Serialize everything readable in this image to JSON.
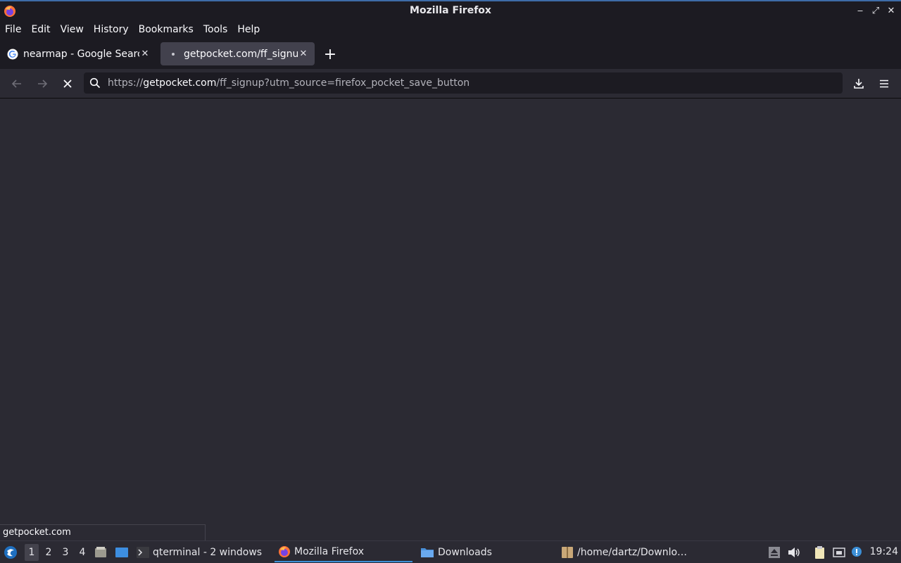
{
  "window": {
    "title": "Mozilla Firefox",
    "controls": [
      "minimize-icon",
      "maximize-icon",
      "close-icon"
    ]
  },
  "menubar": {
    "items": [
      "File",
      "Edit",
      "View",
      "History",
      "Bookmarks",
      "Tools",
      "Help"
    ]
  },
  "tabs": [
    {
      "label": "nearmap - Google Search",
      "icon": "google-icon",
      "active": false
    },
    {
      "label": "getpocket.com/ff_signup",
      "icon": "loading-dot-icon",
      "active": true
    }
  ],
  "navbar": {
    "url_prefix": "https://",
    "url_host": "getpocket.com",
    "url_path": "/ff_signup?utm_source=firefox_pocket_save_button"
  },
  "status": {
    "text": "getpocket.com"
  },
  "taskbar": {
    "workspaces": [
      "1",
      "2",
      "3",
      "4"
    ],
    "active_workspace": "1",
    "tasks": [
      {
        "label": "qterminal - 2 windows",
        "icon": "terminal-icon"
      },
      {
        "label": "Mozilla Firefox",
        "icon": "firefox-icon",
        "active": true
      },
      {
        "label": "Downloads",
        "icon": "folder-icon"
      },
      {
        "label": "/home/dartz/Downlo…",
        "icon": "archive-icon"
      }
    ],
    "clock": "19:24"
  },
  "colors": {
    "chrome": "#1c1b22",
    "content": "#2b2a33",
    "active_tab": "#42414d",
    "accent": "#3c8fd6"
  }
}
